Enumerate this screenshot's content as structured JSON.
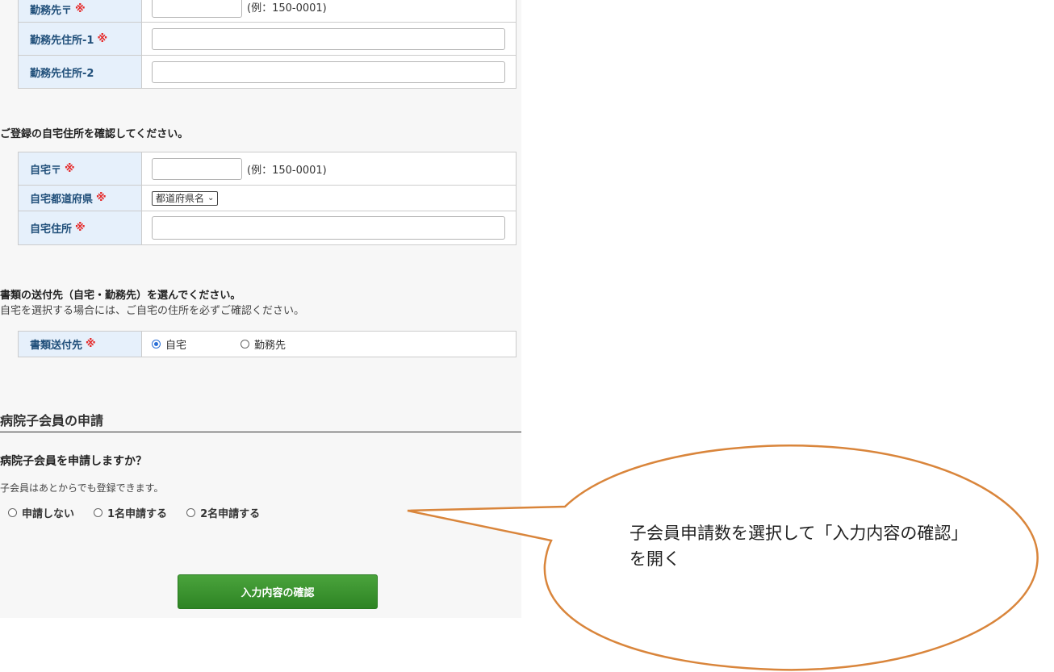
{
  "work": {
    "zip_label": "勤務先〒",
    "zip_hint": "(例：150-0001)",
    "address1_label": "勤務先住所-1",
    "address2_label": "勤務先住所-2",
    "required_mark": "※"
  },
  "home": {
    "heading": "ご登録の自宅住所を確認してください。",
    "zip_label": "自宅〒",
    "zip_hint": "(例：150-0001)",
    "pref_label": "自宅都道府県",
    "pref_selected": "都道府県名",
    "address_label": "自宅住所",
    "required_mark": "※"
  },
  "delivery": {
    "heading": "書類の送付先（自宅・勤務先）を選んでください。",
    "note": "自宅を選択する場合には、ご自宅の住所を必ずご確認ください。",
    "label": "書類送付先",
    "required_mark": "※",
    "options": [
      "自宅",
      "勤務先"
    ],
    "selected": "自宅"
  },
  "child": {
    "section_title": "病院子会員の申請",
    "question": "病院子会員を申請しますか？",
    "note": "子会員はあとからでも登録できます。",
    "options": [
      "申請しない",
      "1名申請する",
      "2名申請する"
    ]
  },
  "confirm_button": "入力内容の確認",
  "callout": {
    "text": "子会員申請数を選択して「入力内容の確認」を開く",
    "stroke_color": "#d9853b"
  },
  "colors": {
    "label_bg": "#e6f0fb",
    "label_text": "#1f4e79",
    "required": "#e52a2a",
    "button": "#3a9630"
  }
}
